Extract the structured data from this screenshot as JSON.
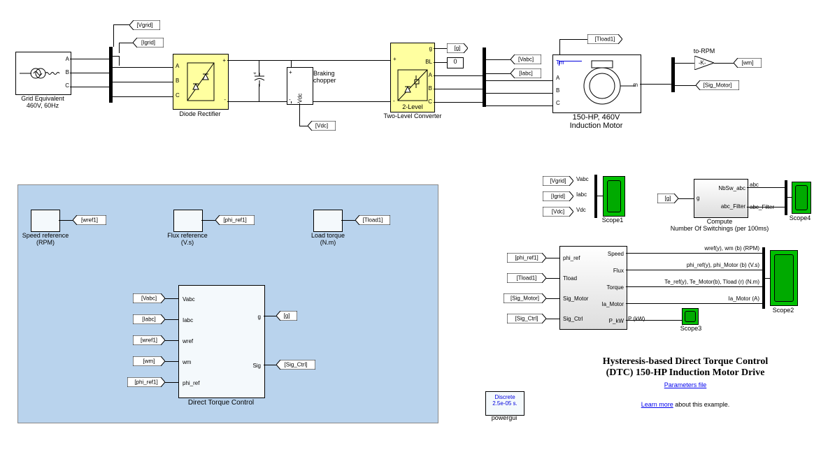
{
  "grid": {
    "name": "Grid Equivalent\n460V, 60Hz",
    "ports": [
      "A",
      "B",
      "C"
    ]
  },
  "rectifier": {
    "name": "Diode Rectifier",
    "ports_in": [
      "A",
      "B",
      "C"
    ],
    "plus": "+",
    "minus": "-"
  },
  "braking": {
    "name": "Braking\nchopper",
    "vdc": "Vdc"
  },
  "converter": {
    "name": "Two-Level Converter",
    "inner": "2-Level",
    "ports_right": [
      "g",
      "BL",
      "A",
      "B",
      "C"
    ],
    "plus": "+",
    "minus": "-"
  },
  "motor": {
    "name": "150-HP, 460V\nInduction Motor",
    "ports_left": [
      "A",
      "B",
      "C"
    ],
    "tm": "Tm",
    "m": "m"
  },
  "gain": {
    "name": "to-RPM",
    "k": "-K-"
  },
  "gotos": [
    {
      "t": "[Vgrid]"
    },
    {
      "t": "[Igrid]"
    },
    {
      "t": "[Vdc]"
    },
    {
      "t": "[g]"
    },
    {
      "t": "0"
    },
    {
      "t": "[Vabc]"
    },
    {
      "t": "[Iabc]"
    },
    {
      "t": "[Tload1]"
    },
    {
      "t": "[wm]"
    },
    {
      "t": "[Sig_Motor]"
    },
    {
      "t": "[wref1]"
    },
    {
      "t": "[phi_ref1]"
    },
    {
      "t": "[Tload1]"
    },
    {
      "t": "[g]"
    },
    {
      "t": "[Sig_Ctrl]"
    },
    {
      "t": "[Vabc]"
    },
    {
      "t": "[Iabc]"
    },
    {
      "t": "[wref1]"
    },
    {
      "t": "[wm]"
    },
    {
      "t": "[phi_ref1]"
    },
    {
      "t": "[Vgrid]"
    },
    {
      "t": "[Igrid]"
    },
    {
      "t": "[Vdc]"
    },
    {
      "t": "[g]"
    },
    {
      "t": "[phi_ref1]"
    },
    {
      "t": "[Tload1]"
    },
    {
      "t": "[Sig_Motor]"
    },
    {
      "t": "[Sig_Ctrl]"
    }
  ],
  "panel": {
    "speed": {
      "name": "Speed reference\n(RPM)"
    },
    "flux": {
      "name": "Flux reference\n(V.s)"
    },
    "load": {
      "name": "Load torque\n(N.m)"
    },
    "dtc": {
      "name": "Direct Torque Control",
      "in": [
        "Vabc",
        "Iabc",
        "wref",
        "wm",
        "phi_ref"
      ],
      "out": [
        "g",
        "Sig"
      ]
    }
  },
  "scope1": {
    "name": "Scope1",
    "in": [
      "Vabc",
      "Iabc",
      "Vdc"
    ]
  },
  "compute": {
    "name": "Compute\nNumber Of Switchings (per 100ms)",
    "in": "g",
    "out": [
      "NbSw_abc",
      "abc_Filter"
    ]
  },
  "scope4": {
    "name": "Scope4",
    "in": [
      "abc",
      "abc_Filter"
    ]
  },
  "monitor": {
    "in": [
      "phi_ref",
      "Tload",
      "Sig_Motor",
      "Sig_Ctrl"
    ],
    "out": [
      "Speed",
      "Flux",
      "Torque",
      "Ia_Motor",
      "P_kW"
    ],
    "labels": [
      "wref(y), wm (b) (RPM)",
      "phi_ref(y), phi_Motor (b)  (V.s)",
      "Te_ref(y), Te_Motor(b), Tload (r) (N.m)",
      "Ia_Motor (A)",
      "P (kW)"
    ]
  },
  "scope2": {
    "name": "Scope2"
  },
  "scope3": {
    "name": "Scope3"
  },
  "powergui": {
    "name": "powergui",
    "text": "Discrete\n2.5e-05 s."
  },
  "title": {
    "l1": "Hysteresis-based Direct Torque Control",
    "l2": "(DTC) 150-HP Induction Motor Drive",
    "link1": "Parameters file",
    "link2": "Learn more",
    "rest": " about this example."
  }
}
